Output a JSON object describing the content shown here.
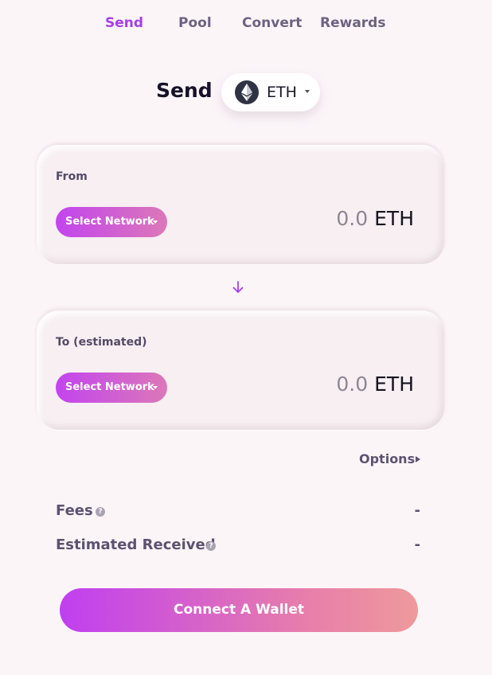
{
  "nav": {
    "tabs": [
      {
        "label": "Send",
        "active": true
      },
      {
        "label": "Pool",
        "active": false
      },
      {
        "label": "Convert",
        "active": false
      },
      {
        "label": "Rewards",
        "active": false
      }
    ]
  },
  "header": {
    "title": "Send",
    "token": {
      "label": "ETH",
      "icon": "ethereum-icon"
    }
  },
  "from": {
    "label": "From",
    "network_button": "Select Network",
    "amount": "0.0",
    "unit": "ETH"
  },
  "to": {
    "label": "To (estimated)",
    "network_button": "Select Network",
    "amount": "0.0",
    "unit": "ETH"
  },
  "swap_icon": "arrow-down-icon",
  "options": {
    "label": "Options"
  },
  "details": {
    "fees": {
      "label": "Fees",
      "value": "-"
    },
    "estimated_received": {
      "label": "Estimated Received",
      "value": "-"
    }
  },
  "connect_button": "Connect A Wallet",
  "colors": {
    "accent": "#a73ee8",
    "background": "#fcf5f8",
    "gradient_start": "#c03ff0",
    "gradient_end": "#ee9a9c"
  }
}
